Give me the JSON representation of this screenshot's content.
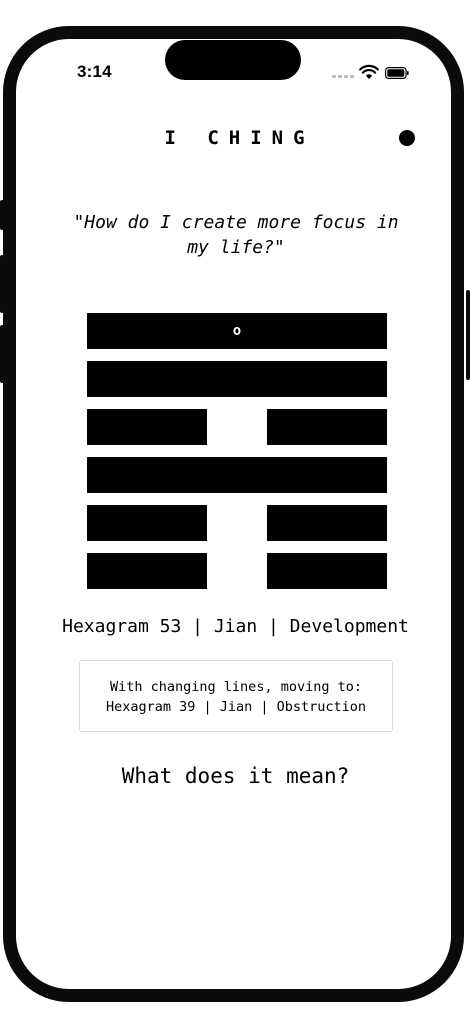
{
  "status_bar": {
    "time": "3:14",
    "signal_icon": "signal-bars-icon",
    "wifi_icon": "wifi-icon",
    "battery_icon": "battery-icon"
  },
  "header": {
    "title": "I CHING",
    "menu_icon": "menu-dot-icon"
  },
  "question": "\"How do I create more focus in my life?\"",
  "hexagram": {
    "lines_top_to_bottom": [
      {
        "type": "yang",
        "changing": true,
        "marker": "o"
      },
      {
        "type": "yang",
        "changing": false
      },
      {
        "type": "yin",
        "changing": false
      },
      {
        "type": "yang",
        "changing": false
      },
      {
        "type": "yin",
        "changing": false
      },
      {
        "type": "yin",
        "changing": false
      }
    ]
  },
  "result": {
    "primary": "Hexagram 53 | Jian | Development",
    "changing_label": "With changing lines, moving to:",
    "relating": "Hexagram 39 | Jian | Obstruction"
  },
  "actions": {
    "meaning_label": "What does it mean?"
  },
  "colors": {
    "frame": "#0b0b0b",
    "ink": "#000000",
    "background": "#ffffff",
    "box_border": "#dadada"
  }
}
